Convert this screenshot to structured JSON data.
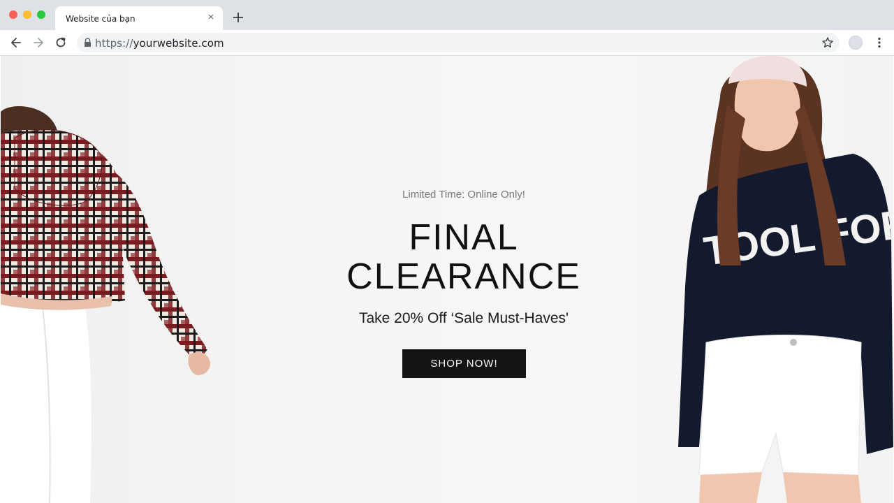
{
  "browser": {
    "tab_title": "Website của bạn",
    "tab_close": "×",
    "url_scheme": "https://",
    "url_host": "yourwebsite.com"
  },
  "hero": {
    "tagline": "Limited Time: Online Only!",
    "headline_line1": "FINAL",
    "headline_line2": "CLEARANCE",
    "subhead": "Take 20% Off ‘Sale Must-Haves'",
    "cta_label": "SHOP NOW!"
  },
  "right_model_sweater_text": "TOOL FOR YOU",
  "colors": {
    "cta_background": "#141414",
    "cta_text": "#ffffff",
    "headline": "#111111",
    "tagline": "#7a7a7a",
    "page_background": "#f5f5f5"
  }
}
